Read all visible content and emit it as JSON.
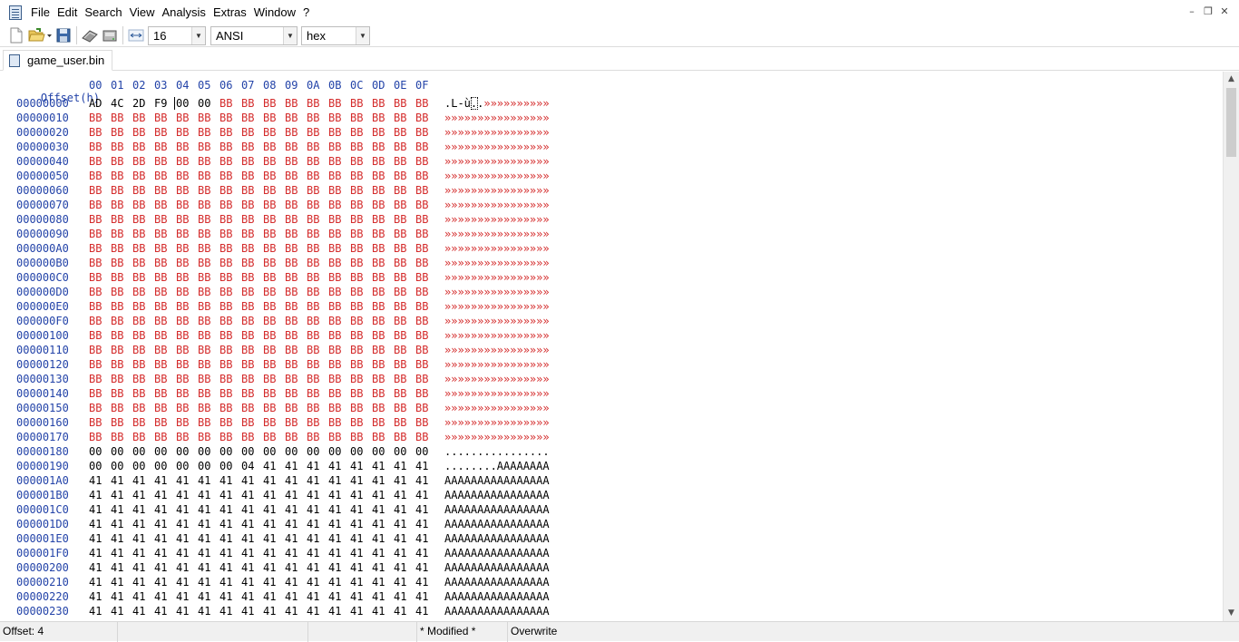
{
  "menubar": {
    "items": [
      "File",
      "Edit",
      "Search",
      "View",
      "Analysis",
      "Extras",
      "Window",
      "?"
    ]
  },
  "window_controls": [
    "minimize",
    "restore",
    "close"
  ],
  "toolbar": {
    "bytes_per_row": "16",
    "charset": "ANSI",
    "offset_base": "hex"
  },
  "tab": {
    "filename": "game_user.bin"
  },
  "hex_view": {
    "header_label": "Offset(h)",
    "column_headers": [
      "00",
      "01",
      "02",
      "03",
      "04",
      "05",
      "06",
      "07",
      "08",
      "09",
      "0A",
      "0B",
      "0C",
      "0D",
      "0E",
      "0F"
    ],
    "rows": [
      {
        "offset": "00000000",
        "bytes": [
          "AD",
          "4C",
          "2D",
          "F9",
          "00",
          "00",
          "BB",
          "BB",
          "BB",
          "BB",
          "BB",
          "BB",
          "BB",
          "BB",
          "BB",
          "BB"
        ],
        "ascii": ".L-ù..»»»»»»»»»»"
      },
      {
        "offset": "00000010",
        "bytes": [
          "BB",
          "BB",
          "BB",
          "BB",
          "BB",
          "BB",
          "BB",
          "BB",
          "BB",
          "BB",
          "BB",
          "BB",
          "BB",
          "BB",
          "BB",
          "BB"
        ],
        "ascii": "»»»»»»»»»»»»»»»»"
      },
      {
        "offset": "00000020",
        "bytes": [
          "BB",
          "BB",
          "BB",
          "BB",
          "BB",
          "BB",
          "BB",
          "BB",
          "BB",
          "BB",
          "BB",
          "BB",
          "BB",
          "BB",
          "BB",
          "BB"
        ],
        "ascii": "»»»»»»»»»»»»»»»»"
      },
      {
        "offset": "00000030",
        "bytes": [
          "BB",
          "BB",
          "BB",
          "BB",
          "BB",
          "BB",
          "BB",
          "BB",
          "BB",
          "BB",
          "BB",
          "BB",
          "BB",
          "BB",
          "BB",
          "BB"
        ],
        "ascii": "»»»»»»»»»»»»»»»»"
      },
      {
        "offset": "00000040",
        "bytes": [
          "BB",
          "BB",
          "BB",
          "BB",
          "BB",
          "BB",
          "BB",
          "BB",
          "BB",
          "BB",
          "BB",
          "BB",
          "BB",
          "BB",
          "BB",
          "BB"
        ],
        "ascii": "»»»»»»»»»»»»»»»»"
      },
      {
        "offset": "00000050",
        "bytes": [
          "BB",
          "BB",
          "BB",
          "BB",
          "BB",
          "BB",
          "BB",
          "BB",
          "BB",
          "BB",
          "BB",
          "BB",
          "BB",
          "BB",
          "BB",
          "BB"
        ],
        "ascii": "»»»»»»»»»»»»»»»»"
      },
      {
        "offset": "00000060",
        "bytes": [
          "BB",
          "BB",
          "BB",
          "BB",
          "BB",
          "BB",
          "BB",
          "BB",
          "BB",
          "BB",
          "BB",
          "BB",
          "BB",
          "BB",
          "BB",
          "BB"
        ],
        "ascii": "»»»»»»»»»»»»»»»»"
      },
      {
        "offset": "00000070",
        "bytes": [
          "BB",
          "BB",
          "BB",
          "BB",
          "BB",
          "BB",
          "BB",
          "BB",
          "BB",
          "BB",
          "BB",
          "BB",
          "BB",
          "BB",
          "BB",
          "BB"
        ],
        "ascii": "»»»»»»»»»»»»»»»»"
      },
      {
        "offset": "00000080",
        "bytes": [
          "BB",
          "BB",
          "BB",
          "BB",
          "BB",
          "BB",
          "BB",
          "BB",
          "BB",
          "BB",
          "BB",
          "BB",
          "BB",
          "BB",
          "BB",
          "BB"
        ],
        "ascii": "»»»»»»»»»»»»»»»»"
      },
      {
        "offset": "00000090",
        "bytes": [
          "BB",
          "BB",
          "BB",
          "BB",
          "BB",
          "BB",
          "BB",
          "BB",
          "BB",
          "BB",
          "BB",
          "BB",
          "BB",
          "BB",
          "BB",
          "BB"
        ],
        "ascii": "»»»»»»»»»»»»»»»»"
      },
      {
        "offset": "000000A0",
        "bytes": [
          "BB",
          "BB",
          "BB",
          "BB",
          "BB",
          "BB",
          "BB",
          "BB",
          "BB",
          "BB",
          "BB",
          "BB",
          "BB",
          "BB",
          "BB",
          "BB"
        ],
        "ascii": "»»»»»»»»»»»»»»»»"
      },
      {
        "offset": "000000B0",
        "bytes": [
          "BB",
          "BB",
          "BB",
          "BB",
          "BB",
          "BB",
          "BB",
          "BB",
          "BB",
          "BB",
          "BB",
          "BB",
          "BB",
          "BB",
          "BB",
          "BB"
        ],
        "ascii": "»»»»»»»»»»»»»»»»"
      },
      {
        "offset": "000000C0",
        "bytes": [
          "BB",
          "BB",
          "BB",
          "BB",
          "BB",
          "BB",
          "BB",
          "BB",
          "BB",
          "BB",
          "BB",
          "BB",
          "BB",
          "BB",
          "BB",
          "BB"
        ],
        "ascii": "»»»»»»»»»»»»»»»»"
      },
      {
        "offset": "000000D0",
        "bytes": [
          "BB",
          "BB",
          "BB",
          "BB",
          "BB",
          "BB",
          "BB",
          "BB",
          "BB",
          "BB",
          "BB",
          "BB",
          "BB",
          "BB",
          "BB",
          "BB"
        ],
        "ascii": "»»»»»»»»»»»»»»»»"
      },
      {
        "offset": "000000E0",
        "bytes": [
          "BB",
          "BB",
          "BB",
          "BB",
          "BB",
          "BB",
          "BB",
          "BB",
          "BB",
          "BB",
          "BB",
          "BB",
          "BB",
          "BB",
          "BB",
          "BB"
        ],
        "ascii": "»»»»»»»»»»»»»»»»"
      },
      {
        "offset": "000000F0",
        "bytes": [
          "BB",
          "BB",
          "BB",
          "BB",
          "BB",
          "BB",
          "BB",
          "BB",
          "BB",
          "BB",
          "BB",
          "BB",
          "BB",
          "BB",
          "BB",
          "BB"
        ],
        "ascii": "»»»»»»»»»»»»»»»»"
      },
      {
        "offset": "00000100",
        "bytes": [
          "BB",
          "BB",
          "BB",
          "BB",
          "BB",
          "BB",
          "BB",
          "BB",
          "BB",
          "BB",
          "BB",
          "BB",
          "BB",
          "BB",
          "BB",
          "BB"
        ],
        "ascii": "»»»»»»»»»»»»»»»»"
      },
      {
        "offset": "00000110",
        "bytes": [
          "BB",
          "BB",
          "BB",
          "BB",
          "BB",
          "BB",
          "BB",
          "BB",
          "BB",
          "BB",
          "BB",
          "BB",
          "BB",
          "BB",
          "BB",
          "BB"
        ],
        "ascii": "»»»»»»»»»»»»»»»»"
      },
      {
        "offset": "00000120",
        "bytes": [
          "BB",
          "BB",
          "BB",
          "BB",
          "BB",
          "BB",
          "BB",
          "BB",
          "BB",
          "BB",
          "BB",
          "BB",
          "BB",
          "BB",
          "BB",
          "BB"
        ],
        "ascii": "»»»»»»»»»»»»»»»»"
      },
      {
        "offset": "00000130",
        "bytes": [
          "BB",
          "BB",
          "BB",
          "BB",
          "BB",
          "BB",
          "BB",
          "BB",
          "BB",
          "BB",
          "BB",
          "BB",
          "BB",
          "BB",
          "BB",
          "BB"
        ],
        "ascii": "»»»»»»»»»»»»»»»»"
      },
      {
        "offset": "00000140",
        "bytes": [
          "BB",
          "BB",
          "BB",
          "BB",
          "BB",
          "BB",
          "BB",
          "BB",
          "BB",
          "BB",
          "BB",
          "BB",
          "BB",
          "BB",
          "BB",
          "BB"
        ],
        "ascii": "»»»»»»»»»»»»»»»»"
      },
      {
        "offset": "00000150",
        "bytes": [
          "BB",
          "BB",
          "BB",
          "BB",
          "BB",
          "BB",
          "BB",
          "BB",
          "BB",
          "BB",
          "BB",
          "BB",
          "BB",
          "BB",
          "BB",
          "BB"
        ],
        "ascii": "»»»»»»»»»»»»»»»»"
      },
      {
        "offset": "00000160",
        "bytes": [
          "BB",
          "BB",
          "BB",
          "BB",
          "BB",
          "BB",
          "BB",
          "BB",
          "BB",
          "BB",
          "BB",
          "BB",
          "BB",
          "BB",
          "BB",
          "BB"
        ],
        "ascii": "»»»»»»»»»»»»»»»»"
      },
      {
        "offset": "00000170",
        "bytes": [
          "BB",
          "BB",
          "BB",
          "BB",
          "BB",
          "BB",
          "BB",
          "BB",
          "BB",
          "BB",
          "BB",
          "BB",
          "BB",
          "BB",
          "BB",
          "BB"
        ],
        "ascii": "»»»»»»»»»»»»»»»»"
      },
      {
        "offset": "00000180",
        "bytes": [
          "00",
          "00",
          "00",
          "00",
          "00",
          "00",
          "00",
          "00",
          "00",
          "00",
          "00",
          "00",
          "00",
          "00",
          "00",
          "00"
        ],
        "ascii": "................"
      },
      {
        "offset": "00000190",
        "bytes": [
          "00",
          "00",
          "00",
          "00",
          "00",
          "00",
          "00",
          "04",
          "41",
          "41",
          "41",
          "41",
          "41",
          "41",
          "41",
          "41"
        ],
        "ascii": "........AAAAAAAA"
      },
      {
        "offset": "000001A0",
        "bytes": [
          "41",
          "41",
          "41",
          "41",
          "41",
          "41",
          "41",
          "41",
          "41",
          "41",
          "41",
          "41",
          "41",
          "41",
          "41",
          "41"
        ],
        "ascii": "AAAAAAAAAAAAAAAA"
      },
      {
        "offset": "000001B0",
        "bytes": [
          "41",
          "41",
          "41",
          "41",
          "41",
          "41",
          "41",
          "41",
          "41",
          "41",
          "41",
          "41",
          "41",
          "41",
          "41",
          "41"
        ],
        "ascii": "AAAAAAAAAAAAAAAA"
      },
      {
        "offset": "000001C0",
        "bytes": [
          "41",
          "41",
          "41",
          "41",
          "41",
          "41",
          "41",
          "41",
          "41",
          "41",
          "41",
          "41",
          "41",
          "41",
          "41",
          "41"
        ],
        "ascii": "AAAAAAAAAAAAAAAA"
      },
      {
        "offset": "000001D0",
        "bytes": [
          "41",
          "41",
          "41",
          "41",
          "41",
          "41",
          "41",
          "41",
          "41",
          "41",
          "41",
          "41",
          "41",
          "41",
          "41",
          "41"
        ],
        "ascii": "AAAAAAAAAAAAAAAA"
      },
      {
        "offset": "000001E0",
        "bytes": [
          "41",
          "41",
          "41",
          "41",
          "41",
          "41",
          "41",
          "41",
          "41",
          "41",
          "41",
          "41",
          "41",
          "41",
          "41",
          "41"
        ],
        "ascii": "AAAAAAAAAAAAAAAA"
      },
      {
        "offset": "000001F0",
        "bytes": [
          "41",
          "41",
          "41",
          "41",
          "41",
          "41",
          "41",
          "41",
          "41",
          "41",
          "41",
          "41",
          "41",
          "41",
          "41",
          "41"
        ],
        "ascii": "AAAAAAAAAAAAAAAA"
      },
      {
        "offset": "00000200",
        "bytes": [
          "41",
          "41",
          "41",
          "41",
          "41",
          "41",
          "41",
          "41",
          "41",
          "41",
          "41",
          "41",
          "41",
          "41",
          "41",
          "41"
        ],
        "ascii": "AAAAAAAAAAAAAAAA"
      },
      {
        "offset": "00000210",
        "bytes": [
          "41",
          "41",
          "41",
          "41",
          "41",
          "41",
          "41",
          "41",
          "41",
          "41",
          "41",
          "41",
          "41",
          "41",
          "41",
          "41"
        ],
        "ascii": "AAAAAAAAAAAAAAAA"
      },
      {
        "offset": "00000220",
        "bytes": [
          "41",
          "41",
          "41",
          "41",
          "41",
          "41",
          "41",
          "41",
          "41",
          "41",
          "41",
          "41",
          "41",
          "41",
          "41",
          "41"
        ],
        "ascii": "AAAAAAAAAAAAAAAA"
      },
      {
        "offset": "00000230",
        "bytes": [
          "41",
          "41",
          "41",
          "41",
          "41",
          "41",
          "41",
          "41",
          "41",
          "41",
          "41",
          "41",
          "41",
          "41",
          "41",
          "41"
        ],
        "ascii": "AAAAAAAAAAAAAAAA"
      }
    ],
    "cursor_byte_index": 4,
    "modified_color": "#d42c2c",
    "offset_color": "#2343a8"
  },
  "statusbar": {
    "offset": "Offset: 4",
    "modified": "* Modified *",
    "mode": "Overwrite"
  },
  "icons": [
    "app-icon",
    "new-file-icon",
    "open-file-icon",
    "save-icon",
    "ram-icon",
    "disk-icon",
    "bytes-per-row-icon"
  ]
}
